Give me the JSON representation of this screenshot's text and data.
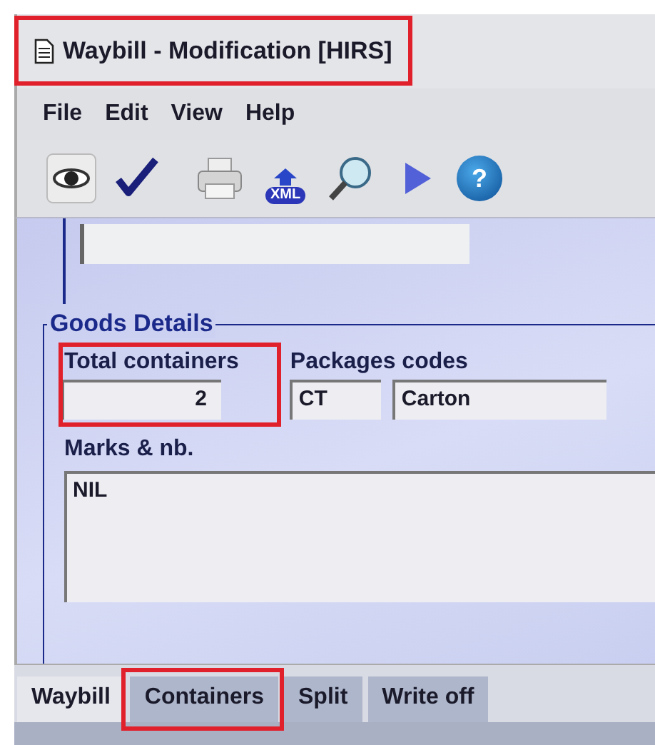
{
  "window": {
    "title": "Waybill - Modification [HIRS]",
    "highlighted": true
  },
  "menu": [
    "File",
    "Edit",
    "View",
    "Help"
  ],
  "toolbar": [
    {
      "kind": "view"
    },
    {
      "kind": "check"
    },
    {
      "kind": "print"
    },
    {
      "kind": "xml",
      "label": "XML"
    },
    {
      "kind": "search"
    },
    {
      "kind": "play"
    },
    {
      "kind": "help",
      "label": "?"
    }
  ],
  "goods_details": {
    "title": "Goods Details",
    "total_containers": {
      "label": "Total containers",
      "value": "2",
      "highlighted": true
    },
    "packages_codes": {
      "label": "Packages codes",
      "code": "CT",
      "name": "Carton"
    },
    "marks": {
      "label": "Marks & nb.",
      "value": "NIL"
    }
  },
  "tabs": [
    {
      "label": "Waybill",
      "selected": true,
      "highlighted": false
    },
    {
      "label": "Containers",
      "selected": false,
      "highlighted": true
    },
    {
      "label": "Split",
      "selected": false,
      "highlighted": false
    },
    {
      "label": "Write off",
      "selected": false,
      "highlighted": false
    }
  ]
}
